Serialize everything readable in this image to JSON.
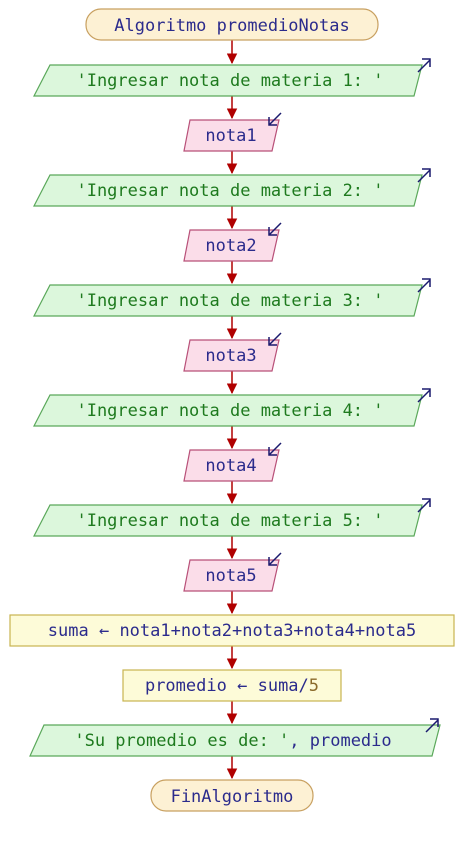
{
  "flowchart": {
    "start": "Algoritmo promedioNotas",
    "end": "FinAlgoritmo",
    "steps": [
      {
        "kind": "output",
        "text": "'Ingresar nota de materia 1: '"
      },
      {
        "kind": "input",
        "text": "nota1"
      },
      {
        "kind": "output",
        "text": "'Ingresar nota de materia 2: '"
      },
      {
        "kind": "input",
        "text": "nota2"
      },
      {
        "kind": "output",
        "text": "'Ingresar nota de materia 3: '"
      },
      {
        "kind": "input",
        "text": "nota3"
      },
      {
        "kind": "output",
        "text": "'Ingresar nota de materia 4: '"
      },
      {
        "kind": "input",
        "text": "nota4"
      },
      {
        "kind": "output",
        "text": "'Ingresar nota de materia 5: '"
      },
      {
        "kind": "input",
        "text": "nota5"
      },
      {
        "kind": "assign",
        "target": "suma",
        "arrow": "←",
        "expr": "nota1+nota2+nota3+nota4+nota5"
      },
      {
        "kind": "assign",
        "target": "promedio",
        "arrow": "←",
        "expr_var": "suma/",
        "expr_num": "5"
      },
      {
        "kind": "output",
        "text_str": "'Su promedio es de: '",
        "text_rest": ", promedio"
      }
    ]
  },
  "colors": {
    "terminal_fill": "#fdf1d4",
    "terminal_stroke": "#c8a060",
    "terminal_text": "#2b2b8c",
    "output_fill": "#dcf7dc",
    "output_stroke": "#5aa85a",
    "output_text": "#1e7a1e",
    "input_fill": "#fbdde9",
    "input_stroke": "#b85078",
    "input_text": "#2b2b8c",
    "assign_fill": "#fdfbd8",
    "assign_stroke": "#c8b450",
    "assign_text": "#2b2b8c",
    "number_text": "#8a6a2a",
    "connector": "#b00000",
    "io_arrow": "#1a1a6e"
  }
}
